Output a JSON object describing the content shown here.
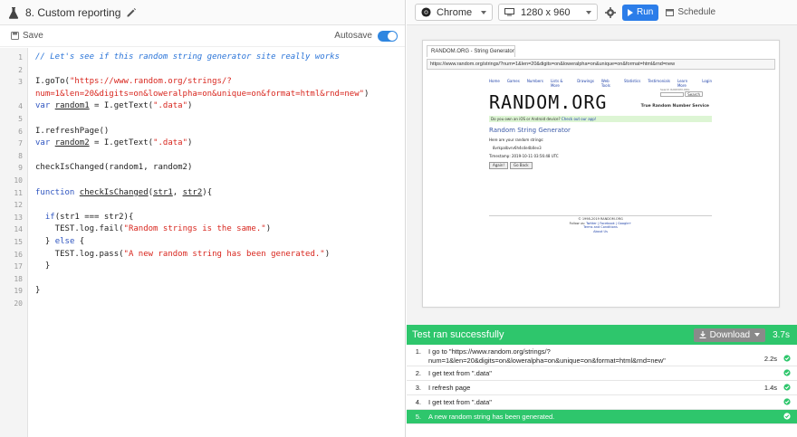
{
  "left": {
    "title": "8. Custom reporting",
    "save_label": "Save",
    "autosave_label": "Autosave",
    "code_lines": [
      {
        "n": "1",
        "parts": [
          {
            "t": "// Let's see if this random string generator site really works",
            "c": "cm"
          }
        ]
      },
      {
        "n": "2",
        "parts": []
      },
      {
        "n": "3",
        "parts": [
          {
            "t": "I.goTo(",
            "c": ""
          },
          {
            "t": "\"https://www.random.org/strings/?",
            "c": "st"
          }
        ]
      },
      {
        "n": "",
        "parts": [
          {
            "t": "num=1&len=20&digits=on&loweralpha=on&unique=on&format=html&rnd=new\"",
            "c": "st"
          },
          {
            "t": ")",
            "c": ""
          }
        ]
      },
      {
        "n": "4",
        "parts": [
          {
            "t": "var ",
            "c": "kw"
          },
          {
            "t": "random1",
            "c": "un"
          },
          {
            "t": " = I.getText(",
            "c": ""
          },
          {
            "t": "\".data\"",
            "c": "st"
          },
          {
            "t": ")",
            "c": ""
          }
        ]
      },
      {
        "n": "5",
        "parts": []
      },
      {
        "n": "6",
        "parts": [
          {
            "t": "I.refreshPage()",
            "c": ""
          }
        ]
      },
      {
        "n": "7",
        "parts": [
          {
            "t": "var ",
            "c": "kw"
          },
          {
            "t": "random2",
            "c": "un"
          },
          {
            "t": " = I.getText(",
            "c": ""
          },
          {
            "t": "\".data\"",
            "c": "st"
          },
          {
            "t": ")",
            "c": ""
          }
        ]
      },
      {
        "n": "8",
        "parts": []
      },
      {
        "n": "9",
        "parts": [
          {
            "t": "checkIsChanged(random1, random2)",
            "c": ""
          }
        ]
      },
      {
        "n": "10",
        "parts": []
      },
      {
        "n": "11",
        "parts": [
          {
            "t": "function ",
            "c": "kw"
          },
          {
            "t": "checkIsChanged",
            "c": "un"
          },
          {
            "t": "(",
            "c": ""
          },
          {
            "t": "str1",
            "c": "un"
          },
          {
            "t": ", ",
            "c": ""
          },
          {
            "t": "str2",
            "c": "un"
          },
          {
            "t": "){",
            "c": ""
          }
        ]
      },
      {
        "n": "12",
        "parts": []
      },
      {
        "n": "13",
        "parts": [
          {
            "t": "  ",
            "c": ""
          },
          {
            "t": "if",
            "c": "kw"
          },
          {
            "t": "(str1 === str2){",
            "c": ""
          }
        ]
      },
      {
        "n": "14",
        "parts": [
          {
            "t": "    TEST.log.fail(",
            "c": ""
          },
          {
            "t": "\"Random strings is the same.\"",
            "c": "st"
          },
          {
            "t": ")",
            "c": ""
          }
        ]
      },
      {
        "n": "15",
        "parts": [
          {
            "t": "  } ",
            "c": ""
          },
          {
            "t": "else",
            "c": "kw"
          },
          {
            "t": " {",
            "c": ""
          }
        ]
      },
      {
        "n": "16",
        "parts": [
          {
            "t": "    TEST.log.pass(",
            "c": ""
          },
          {
            "t": "\"A new random string has been generated.\"",
            "c": "st"
          },
          {
            "t": ")",
            "c": ""
          }
        ]
      },
      {
        "n": "17",
        "parts": [
          {
            "t": "  }",
            "c": ""
          }
        ]
      },
      {
        "n": "18",
        "parts": []
      },
      {
        "n": "19",
        "parts": [
          {
            "t": "}",
            "c": ""
          }
        ]
      },
      {
        "n": "20",
        "parts": []
      }
    ]
  },
  "toolbar": {
    "browser": "Chrome",
    "resolution": "1280 x 960",
    "run_label": "Run",
    "schedule_label": "Schedule"
  },
  "preview": {
    "tab_title": "RANDOM.ORG - String Generator",
    "url": "https://www.random.org/strings/?num=1&len=20&digits=on&loweralpha=on&unique=on&format=html&rnd=new",
    "nav": [
      "Home",
      "Games",
      "Numbers",
      "Lists & More",
      "Drawings",
      "Web Tools",
      "Statistics",
      "Testimonials",
      "Learn More",
      "Login"
    ],
    "logo": "RANDOM.ORG",
    "search_hint": "Search RANDOM.ORG",
    "search_button": "Search",
    "tagline": "True Random Number Service",
    "banner_text": "Do you own an iOS or Android device? ",
    "banner_link": "Check out our app!",
    "heading": "Random String Generator",
    "here_text": "Here are your random strings:",
    "random_string": "8vrkpalbvrv6h4s4e4b0ev3",
    "timestamp": "Timestamp: 2019-10-11 03:56:48 UTC",
    "again_label": "Again!",
    "goback_label": "Go Back",
    "footer_line1": "© 1998-2019 RANDOM.ORG",
    "footer_line2_prefix": "Follow us: ",
    "footer_line2_links": "Twitter | Facebook | Google+",
    "footer_line3": "Terms and Conditions",
    "footer_line4": "About Us"
  },
  "results": {
    "status": "Test ran successfully",
    "download_label": "Download",
    "total_time": "3.7s",
    "steps": [
      {
        "num": "1.",
        "text1": "I go to \"https://www.random.org/strings/?",
        "text2": "num=1&len=20&digits=on&loweralpha=on&unique=on&format=html&rnd=new\"",
        "dur": "2.2s"
      },
      {
        "num": "2.",
        "text1": "I get text from \".data\"",
        "text2": "",
        "dur": ""
      },
      {
        "num": "3.",
        "text1": "I refresh page",
        "text2": "",
        "dur": "1.4s"
      },
      {
        "num": "4.",
        "text1": "I get text from \".data\"",
        "text2": "",
        "dur": ""
      },
      {
        "num": "5.",
        "text1": "A new random string has been generated.",
        "text2": "",
        "dur": ""
      }
    ],
    "colors": {
      "success": "#2ec66c",
      "run": "#2b7de9"
    }
  }
}
